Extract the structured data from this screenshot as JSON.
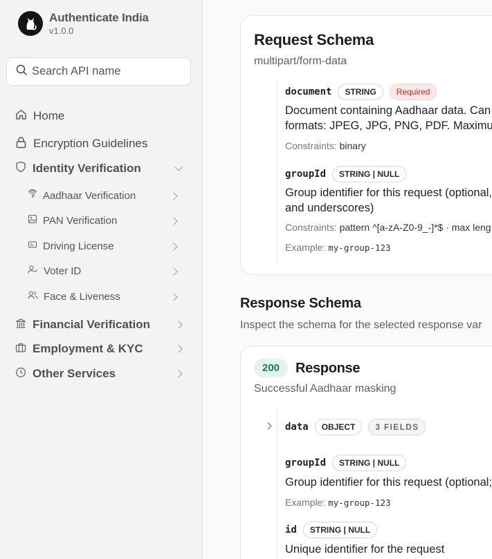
{
  "brand": {
    "name": "Authenticate India",
    "version": "v1.0.0"
  },
  "search": {
    "placeholder": "Search API name"
  },
  "nav": {
    "home": "Home",
    "encryption": "Encryption Guidelines",
    "identity": "Identity Verification",
    "identity_items": [
      "Aadhaar Verification",
      "PAN Verification",
      "Driving License",
      "Voter ID",
      "Face & Liveness"
    ],
    "financial": "Financial Verification",
    "employment": "Employment & KYC",
    "other": "Other Services"
  },
  "request": {
    "title": "Request Schema",
    "content_type": "multipart/form-data",
    "fields": [
      {
        "name": "document",
        "type": "STRING",
        "required": "Required",
        "desc_line1": "Document containing Aadhaar data. Can",
        "desc_line2": "formats: JPEG, JPG, PNG, PDF. Maximu",
        "constraints_label": "Constraints:",
        "constraints": "binary"
      },
      {
        "name": "groupId",
        "type": "STRING | NULL",
        "desc_line1": "Group identifier for this request (optional,",
        "desc_line2": "and underscores)",
        "constraints_label": "Constraints:",
        "constraints": "pattern ^[a-zA-Z0-9_-]*$ · max leng",
        "example_label": "Example:",
        "example": "my-group-123"
      }
    ]
  },
  "response_section": {
    "title": "Response Schema",
    "subtitle": "Inspect the schema for the selected response var"
  },
  "response": {
    "status": "200",
    "title": "Response",
    "subtitle": "Successful Aadhaar masking",
    "fields": [
      {
        "name": "data",
        "type": "OBJECT",
        "count": "3 FIELDS"
      },
      {
        "name": "groupId",
        "type": "STRING | NULL",
        "desc": "Group identifier for this request (optional;",
        "example_label": "Example:",
        "example": "my-group-123"
      },
      {
        "name": "id",
        "type": "STRING | NULL",
        "desc": "Unique identifier for the request"
      }
    ]
  }
}
